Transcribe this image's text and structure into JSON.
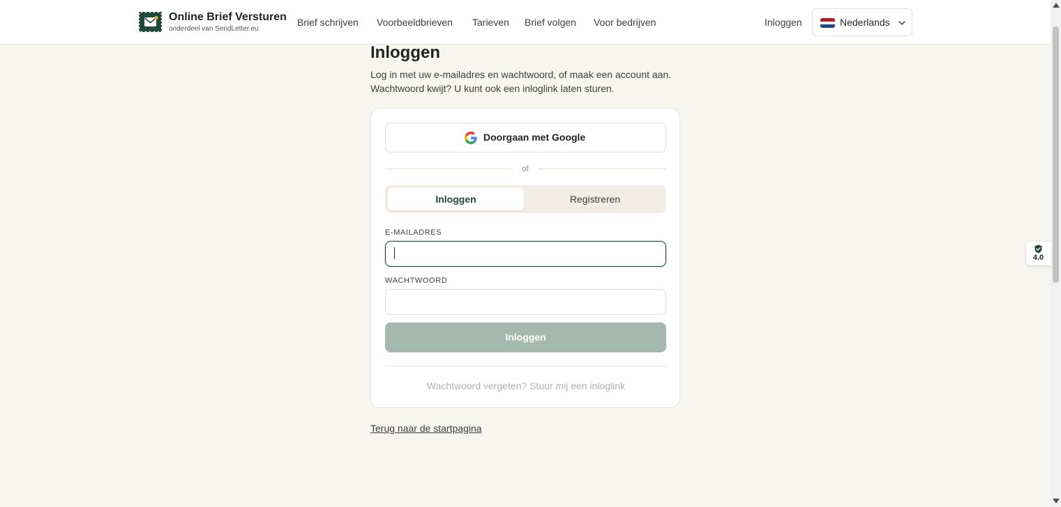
{
  "header": {
    "brand_title": "Online Brief Versturen",
    "brand_subtitle": "onderdeel van SendLetter.eu",
    "nav": [
      "Brief schrijven",
      "Voorbeeldbrieven",
      "Tarieven",
      "Brief volgen",
      "Voor bedrijven"
    ],
    "login_label": "Inloggen",
    "language": "Nederlands"
  },
  "main": {
    "title": "Inloggen",
    "description": "Log in met uw e-mailadres en wachtwoord, of maak een account aan. Wachtwoord kwijt? U kunt ook een inloglink laten sturen.",
    "google_button": "Doorgaan met Google",
    "divider_text": "of",
    "tabs": [
      {
        "label": "Inloggen",
        "active": true
      },
      {
        "label": "Registreren",
        "active": false
      }
    ],
    "email": {
      "label": "E-MAILADRES",
      "value": "",
      "placeholder": ""
    },
    "password": {
      "label": "WACHTWOORD",
      "value": "",
      "placeholder": ""
    },
    "submit_label": "Inloggen",
    "magic_link": "Wachtwoord vergeten? Stuur mij een inloglink",
    "back_link": "Terug naar de startpagina"
  },
  "rating": {
    "value": "4.0"
  },
  "colors": {
    "accent": "#1f4a3a",
    "background": "#f7f5f0",
    "submit_disabled": "#a4b8b0",
    "tab_track": "#f1ece4"
  }
}
